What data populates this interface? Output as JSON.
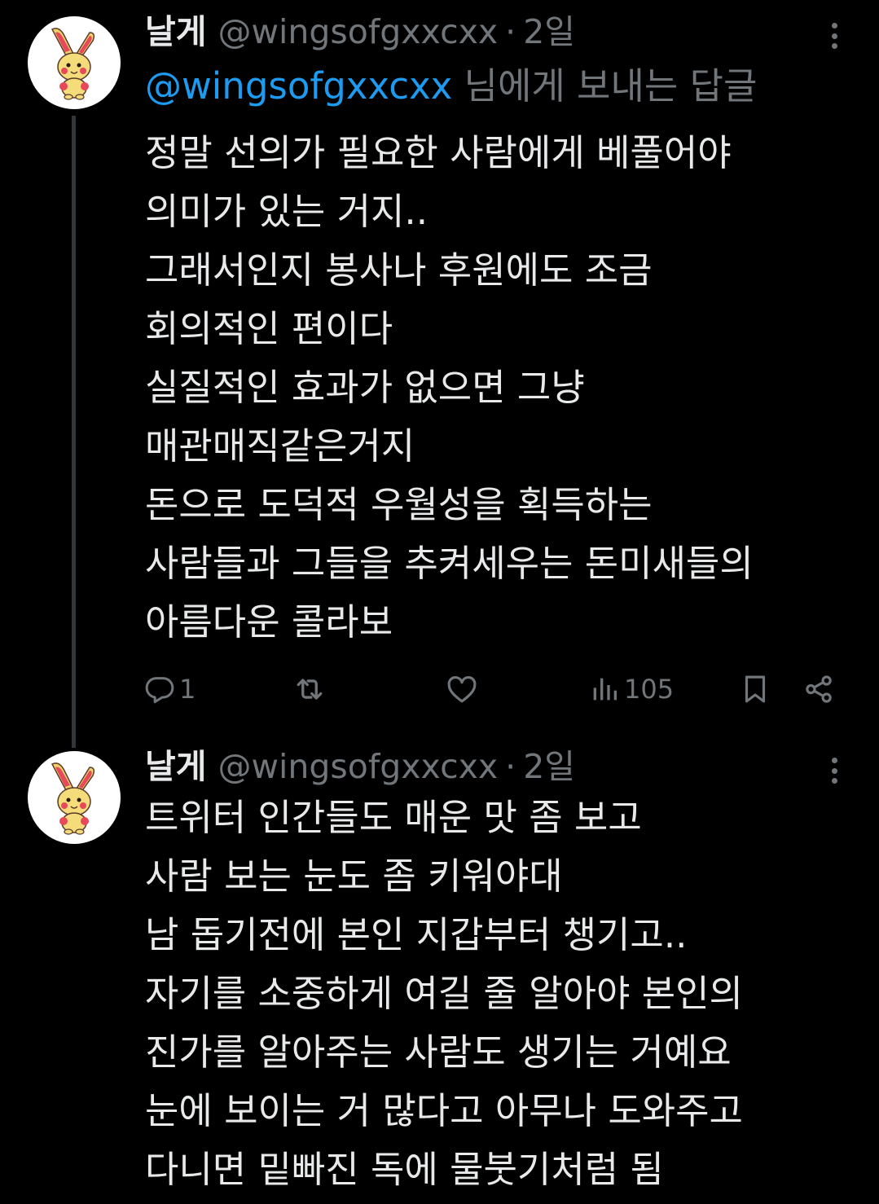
{
  "tweets": [
    {
      "author_name": "날게",
      "handle": "@wingsofgxxcxx",
      "separator": "·",
      "time": "2일",
      "replying_to_handle": "@wingsofgxxcxx",
      "replying_suffix": " 님에게 보내는 답글",
      "lines": [
        "정말 선의가 필요한 사람에게 베풀어야",
        "의미가 있는 거지..",
        "그래서인지 봉사나 후원에도 조금",
        "회의적인 편이다",
        "실질적인 효과가 없으면 그냥",
        "매관매직같은거지",
        "돈으로 도덕적 우월성을 획득하는",
        "사람들과 그들을 추켜세우는 돈미새들의",
        "아름다운 콜라보"
      ],
      "actions": {
        "reply_icon": "reply-icon",
        "reply_count": "1",
        "retweet_icon": "retweet-icon",
        "like_icon": "heart-icon",
        "views_icon": "views-icon",
        "views_count": "105",
        "bookmark_icon": "bookmark-icon",
        "share_icon": "share-icon"
      }
    },
    {
      "author_name": "날게",
      "handle": "@wingsofgxxcxx",
      "separator": "·",
      "time": "2일",
      "lines": [
        "트위터 인간들도 매운 맛 좀 보고",
        "사람 보는 눈도 좀 키워야대",
        "남 돕기전에 본인 지갑부터 챙기고..",
        "자기를 소중하게 여길 줄 알아야 본인의",
        "진가를 알아주는 사람도 생기는 거예요",
        "눈에 보이는 거 많다고 아무나 도와주고",
        "다니면 밑빠진 독에 물붓기처럼 됨"
      ]
    }
  ],
  "colors": {
    "background": "#000000",
    "text_primary": "#e7e9ea",
    "text_secondary": "#71767b",
    "accent": "#1d9bf0",
    "thread_line": "#333639"
  },
  "icons": {
    "avatar": "rabbit-character-avatar",
    "more": "more-options-icon"
  }
}
